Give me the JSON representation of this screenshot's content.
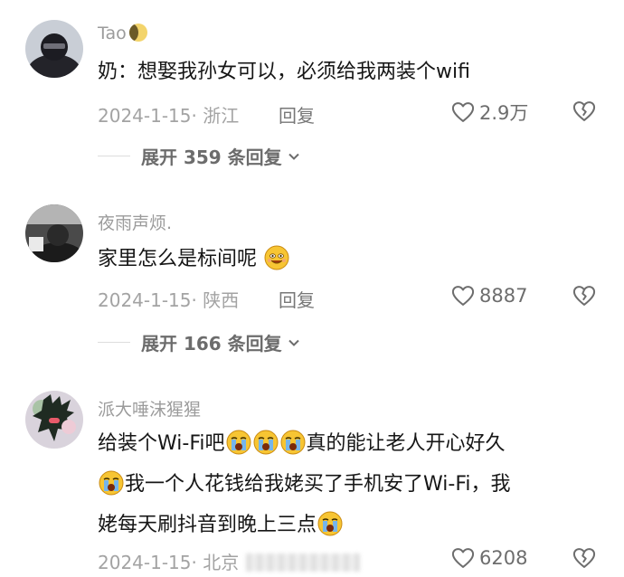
{
  "comments": [
    {
      "username": "Tao",
      "text_lines": [
        "奶：想娶我孙女可以，必须给我两装个wifi"
      ],
      "meta": "2024-1-15· 浙江",
      "reply_label": "回复",
      "likes": "2.9万",
      "expand_label": "展开 359 条回复"
    },
    {
      "username": "夜雨声烦.",
      "text_lines": [
        "家里怎么是标间呢"
      ],
      "meta": "2024-1-15· 陕西",
      "reply_label": "回复",
      "likes": "8887",
      "expand_label": "展开 166 条回复"
    },
    {
      "username": "派大唾沫猩猩",
      "text_lines": [
        "给装个Wi-Fi吧",
        "真的能让老人开心好久",
        "我一个人花钱给我姥买了手机安了Wi-Fi，我",
        "姥每天刷抖音到晚上三点"
      ],
      "meta": "2024-1-15· 北京",
      "likes": "6208"
    }
  ],
  "icons": {
    "like": "heart-outline-icon",
    "dislike": "broken-heart-icon",
    "expand": "chevron-down-icon",
    "emoji_smile": "smiling-face-icon",
    "emoji_cry": "crying-face-icon"
  },
  "colors": {
    "text": "#161616",
    "muted": "#a3a3a3",
    "emoji": "#f7c533"
  }
}
